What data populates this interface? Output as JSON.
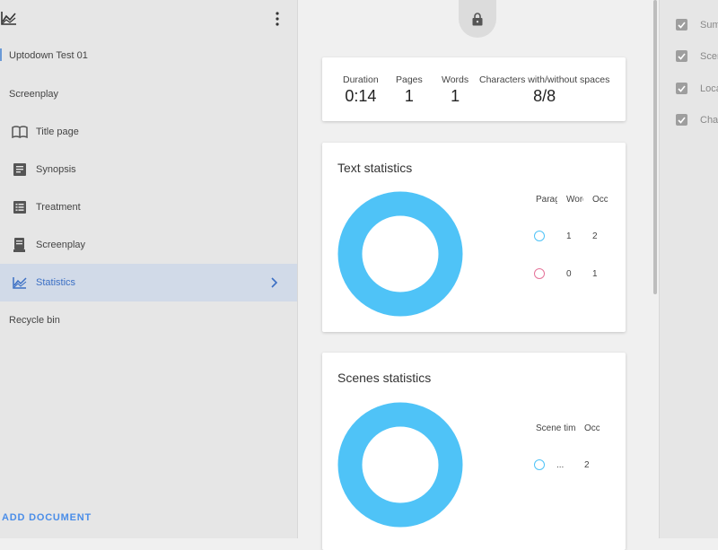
{
  "sidebar": {
    "document_title": "Uptodown Test 01",
    "section_title": "Screenplay",
    "items": [
      {
        "label": "Title page"
      },
      {
        "label": "Synopsis"
      },
      {
        "label": "Treatment"
      },
      {
        "label": "Screenplay"
      },
      {
        "label": "Statistics"
      }
    ],
    "recycle_bin": "Recycle bin",
    "add_document": "ADD DOCUMENT"
  },
  "summary": {
    "duration_label": "Duration",
    "duration_value": "0:14",
    "pages_label": "Pages",
    "pages_value": "1",
    "words_label": "Words",
    "words_value": "1",
    "chars_label": "Characters with/without spaces",
    "chars_value": "8/8"
  },
  "text_statistics": {
    "title": "Text statistics",
    "columns": [
      "Paragraph",
      "Words",
      "Occurrences"
    ],
    "rows": [
      {
        "marker_color": "#4fc3f7",
        "words": "1",
        "occurrences": "2"
      },
      {
        "marker_color": "#e57399",
        "words": "0",
        "occurrences": "1"
      }
    ],
    "donut_color": "#4fc3f7"
  },
  "scenes_statistics": {
    "title": "Scenes statistics",
    "columns": [
      "Scene time",
      "Occurrences"
    ],
    "rows": [
      {
        "marker_color": "#4fc3f7",
        "scene_time": "...",
        "occurrences": "2"
      }
    ],
    "donut_color": "#4fc3f7"
  },
  "right_panel": {
    "items": [
      {
        "label": "Summary"
      },
      {
        "label": "Scenes"
      },
      {
        "label": "Locations"
      },
      {
        "label": "Characters"
      }
    ]
  },
  "colors": {
    "accent": "#3b6fc4",
    "active_bg": "#d1dae8",
    "add_document": "#4a8de8"
  }
}
